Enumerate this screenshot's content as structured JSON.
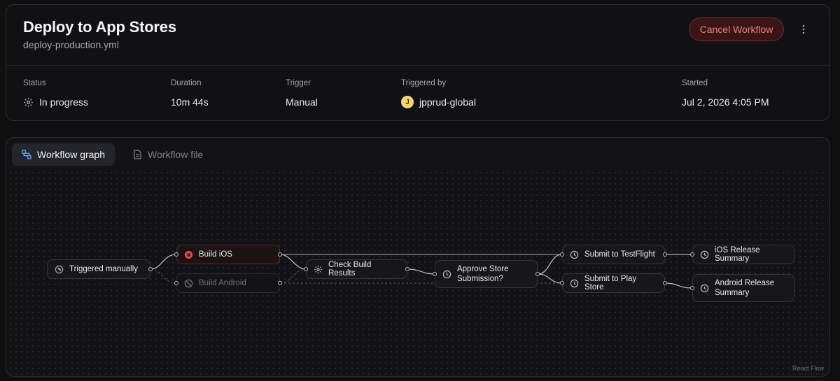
{
  "header": {
    "title": "Deploy to App Stores",
    "file": "deploy-production.yml",
    "cancel_label": "Cancel Workflow",
    "more_icon": "more-vertical-icon"
  },
  "meta": {
    "status_label": "Status",
    "status_value": "In progress",
    "duration_label": "Duration",
    "duration_value": "10m 44s",
    "trigger_label": "Trigger",
    "trigger_value": "Manual",
    "triggered_by_label": "Triggered by",
    "triggered_by_value": "jpprud-global",
    "avatar_initial": "J",
    "started_label": "Started",
    "started_value": "Jul 2, 2026 4:05 PM"
  },
  "tabs": [
    {
      "label": "Workflow graph",
      "active": true,
      "icon": "graph-icon"
    },
    {
      "label": "Workflow file",
      "active": false,
      "icon": "file-icon"
    }
  ],
  "graph": {
    "nodes": {
      "trigger": {
        "label": "Triggered manually",
        "status": "trigger"
      },
      "build_ios": {
        "label": "Build iOS",
        "status": "failed"
      },
      "build_android": {
        "label": "Build Android",
        "status": "skipped"
      },
      "check": {
        "label": "Check Build Results",
        "status": "running"
      },
      "approve": {
        "label": "Approve Store Submission?",
        "status": "pending"
      },
      "testflight": {
        "label": "Submit to TestFlight",
        "status": "pending"
      },
      "playstore": {
        "label": "Submit to Play Store",
        "status": "pending"
      },
      "ios_summary": {
        "label": "iOS Release Summary",
        "status": "pending"
      },
      "android_summary": {
        "label": "Android Release Summary",
        "status": "pending"
      }
    },
    "attribution": "React Flow"
  },
  "colors": {
    "accent_danger": "#f07b7e",
    "failed_icon": "#e5484d",
    "avatar": "#f3d775",
    "active_tab_icon": "#5b9dfa"
  }
}
